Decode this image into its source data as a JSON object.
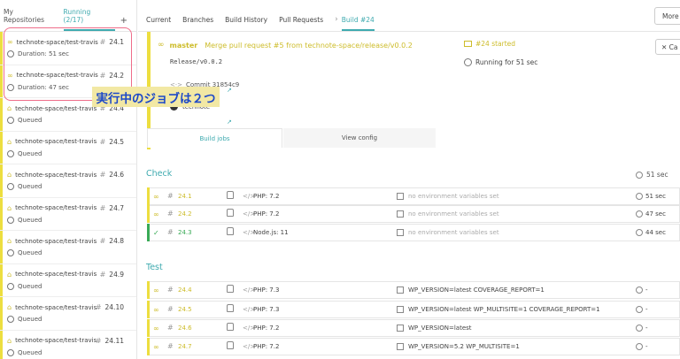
{
  "sidebar": {
    "tabs": [
      "My Repositories",
      "Running (2/17)",
      "+"
    ],
    "jobs": [
      {
        "repo": "technote-space/test-travis",
        "number": "24.1",
        "sub": "Duration: 51 sec",
        "state": "running"
      },
      {
        "repo": "technote-space/test-travis",
        "number": "24.2",
        "sub": "Duration: 47 sec",
        "state": "running"
      },
      {
        "repo": "technote-space/test-travis",
        "number": "24.4",
        "sub": "Queued",
        "state": "queued"
      },
      {
        "repo": "technote-space/test-travis",
        "number": "24.5",
        "sub": "Queued",
        "state": "queued"
      },
      {
        "repo": "technote-space/test-travis",
        "number": "24.6",
        "sub": "Queued",
        "state": "queued"
      },
      {
        "repo": "technote-space/test-travis",
        "number": "24.7",
        "sub": "Queued",
        "state": "queued"
      },
      {
        "repo": "technote-space/test-travis",
        "number": "24.8",
        "sub": "Queued",
        "state": "queued"
      },
      {
        "repo": "technote-space/test-travis",
        "number": "24.9",
        "sub": "Queued",
        "state": "queued"
      },
      {
        "repo": "technote-space/test-travis",
        "number": "24.10",
        "sub": "Queued",
        "state": "queued"
      },
      {
        "repo": "technote-space/test-travis",
        "number": "24.11",
        "sub": "Queued",
        "state": "queued"
      }
    ]
  },
  "overlay_text": "実行中のジョブは２つ",
  "topnav": {
    "tabs": [
      "Current",
      "Branches",
      "Build History",
      "Pull Requests"
    ],
    "active": "Build #24",
    "more": "More o"
  },
  "build": {
    "branch": "master",
    "message": "Merge pull request #5 from technote-space/release/v0.0.2",
    "tag": "Release/v0.0.2",
    "commit": "Commit 31854c9",
    "author": "technote",
    "status": "#24 started",
    "running": "Running for 51 sec",
    "cancel": "Ca"
  },
  "subtabs": {
    "active": "Build jobs",
    "inactive": "View config"
  },
  "sections": [
    {
      "title": "Check",
      "duration": "51 sec",
      "rows": [
        {
          "num": "24.1",
          "lang": "PHP: 7.2",
          "env": "no environment variables set",
          "dur": "51 sec",
          "state": "running"
        },
        {
          "num": "24.2",
          "lang": "PHP: 7.2",
          "env": "no environment variables set",
          "dur": "47 sec",
          "state": "running"
        },
        {
          "num": "24.3",
          "lang": "Node.js: 11",
          "env": "no environment variables set",
          "dur": "44 sec",
          "state": "passed"
        }
      ]
    },
    {
      "title": "Test",
      "duration": "",
      "rows": [
        {
          "num": "24.4",
          "lang": "PHP: 7.3",
          "env": "WP_VERSION=latest COVERAGE_REPORT=1",
          "dur": "-",
          "state": "queued"
        },
        {
          "num": "24.5",
          "lang": "PHP: 7.3",
          "env": "WP_VERSION=latest WP_MULTISITE=1 COVERAGE_REPORT=1",
          "dur": "-",
          "state": "queued"
        },
        {
          "num": "24.6",
          "lang": "PHP: 7.2",
          "env": "WP_VERSION=latest",
          "dur": "-",
          "state": "queued"
        },
        {
          "num": "24.7",
          "lang": "PHP: 7.2",
          "env": "WP_VERSION=5.2 WP_MULTISITE=1",
          "dur": "-",
          "state": "queued"
        }
      ]
    }
  ],
  "colors": {
    "accent": "#3eaaaf",
    "running": "#edde3f",
    "passed": "#39aa56",
    "overlay_bg": "#f2e8a4",
    "overlay_text": "#1c48c8",
    "highlight": "#ef6d8a"
  }
}
